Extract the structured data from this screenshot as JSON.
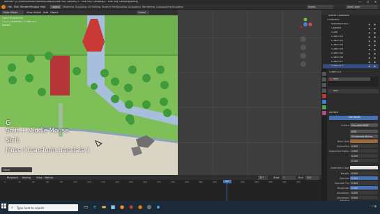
{
  "window": {
    "title": "Blender* [C:\\Users\\Renderhfarhad\\Lowpoly\\Low Poly Course\\2.1 - Low Poly Camping\\1 - Low Poly Camping.blend]",
    "min": "—",
    "max": "☐",
    "close": "✕"
  },
  "menubar": {
    "items": [
      "File",
      "Edit",
      "Render",
      "Window",
      "Help"
    ],
    "workspaces": [
      "Layout",
      "Modeling",
      "Sculpting",
      "UV Editing",
      "Texture Paint",
      "Shading",
      "Animation",
      "Rendering",
      "Compositing",
      "Scripting"
    ],
    "scene": "Scene",
    "view_layer": "View Layer"
  },
  "viewport": {
    "mode": "Object Mode",
    "menus": [
      "View",
      "Select",
      "Add",
      "Object"
    ],
    "orientation": "Global",
    "info_line1": "User Perspective",
    "info_line2": "(327) Collection | Cube.013",
    "info_line3": "Meters",
    "keys": [
      "G",
      "Shift + Middle Mouse",
      "Shift",
      "Move ( transform.translate )"
    ],
    "operator_panel": "Move"
  },
  "outliner": {
    "header": "Scene Collection",
    "items": [
      {
        "label": "Collection",
        "selected": false
      },
      {
        "label": "Armature.001",
        "selected": false
      },
      {
        "label": "Camera",
        "selected": false
      },
      {
        "label": "Cube",
        "selected": false
      },
      {
        "label": "Cube.001",
        "selected": false
      },
      {
        "label": "Cube.002",
        "selected": false
      },
      {
        "label": "Cube.003",
        "selected": false
      },
      {
        "label": "Cube.004",
        "selected": false
      },
      {
        "label": "Cube.005",
        "selected": false
      },
      {
        "label": "Cube.006",
        "selected": false
      },
      {
        "label": "Cube.007",
        "selected": false
      },
      {
        "label": "Cube.011",
        "selected": true
      },
      {
        "label": "Cube.012",
        "selected": false
      },
      {
        "label": "Cube.014",
        "selected": false
      }
    ]
  },
  "properties": {
    "object": "Cube.013",
    "material_slot": "Bark",
    "material_tab": "Surface",
    "material_name": "Bark",
    "use_nodes": "Use Nodes",
    "surface_type": "Principled BSDF",
    "distribution": "GGX",
    "subsurface_method": "Christensen-Burley",
    "rows": [
      {
        "label": "Base Color",
        "value": "",
        "kind": "color"
      },
      {
        "label": "Subsurface",
        "value": "0.000",
        "kind": "num"
      },
      {
        "label": "Subsurface Radius",
        "value": "1.000",
        "kind": "num"
      },
      {
        "label": "",
        "value": "0.200",
        "kind": "num"
      },
      {
        "label": "",
        "value": "0.100",
        "kind": "num"
      },
      {
        "label": "Subsurface Color",
        "value": "",
        "kind": "white"
      },
      {
        "label": "Metallic",
        "value": "0.000",
        "kind": "num"
      },
      {
        "label": "Specular",
        "value": "0.500",
        "kind": "blue"
      },
      {
        "label": "Specular Tint",
        "value": "0.000",
        "kind": "num"
      },
      {
        "label": "Roughness",
        "value": "0.500",
        "kind": "blue"
      },
      {
        "label": "Anisotropic",
        "value": "0.000",
        "kind": "num"
      },
      {
        "label": "Anisotropic Rotation",
        "value": "0.000",
        "kind": "num"
      }
    ]
  },
  "timeline": {
    "menus": [
      "Playback",
      "Keying",
      "View",
      "Marker"
    ],
    "current_frame": "327",
    "start_label": "Start",
    "start": "1",
    "end_label": "End",
    "end": "250",
    "ticks": [
      "0",
      "20",
      "40",
      "60",
      "80",
      "100",
      "120",
      "140",
      "160",
      "180",
      "200",
      "220",
      "240",
      "260",
      "280",
      "300",
      "320",
      "340",
      "360",
      "380",
      "400",
      "420"
    ]
  },
  "taskbar": {
    "search_placeholder": "Type here to search",
    "icons": [
      "windows-logo-icon",
      "task-view-icon",
      "edge-icon",
      "file-explorer-icon",
      "store-icon",
      "firefox-icon",
      "chrome-icon",
      "blender-icon",
      "obs-icon",
      "photoshop-icon"
    ]
  },
  "colors": {
    "grass": "#7fbf58",
    "dark_grass": "#6fb24e",
    "river": "#9bb7d6",
    "beach": "#d9d4c3",
    "tree": "#3f9a3b",
    "tent": "#c83a35",
    "accent": "#4772b3"
  }
}
